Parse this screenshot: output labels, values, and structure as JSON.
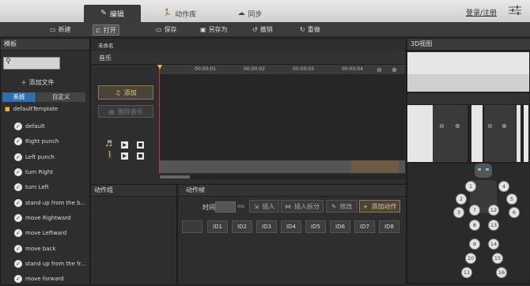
{
  "top_tabs": [
    {
      "label": "编辑"
    },
    {
      "label": "动作库"
    },
    {
      "label": "同步"
    }
  ],
  "account": {
    "login_label": "登录/注册"
  },
  "toolbar": {
    "new": "新建",
    "open": "打开",
    "save": "保存",
    "save_as": "另存为",
    "undo": "撤销",
    "redo": "重做"
  },
  "left_panel": {
    "title": "模板",
    "search_placeholder": "",
    "add_file": "添加文件",
    "seg_system": "系统",
    "seg_custom": "自定义",
    "folder": "defaultTemplate",
    "items": [
      "default",
      "Right punch",
      "Left punch",
      "turn Right",
      "turn Left",
      "stand up from the b...",
      "move Rightward",
      "move Leftward",
      "move back",
      "stand up from the fr...",
      "move forward"
    ]
  },
  "editor": {
    "title": "未命名",
    "music_label": "音乐",
    "add_button": "添加",
    "delete_music": "删除音乐",
    "timeline_ticks": [
      "00:00:01",
      "00:00:02",
      "00:00:03",
      "00:00:04"
    ]
  },
  "action_group": {
    "title": "动作组"
  },
  "action_frames": {
    "title": "动作帧",
    "time_label": "时间",
    "time_unit": "ms",
    "insert": "插入",
    "insert_split": "插入拆分",
    "modify": "修改",
    "add_action": "添加动作",
    "ids": [
      "ID1",
      "ID2",
      "ID3",
      "ID4",
      "ID5",
      "ID6",
      "ID7",
      "ID8"
    ]
  },
  "view3d": {
    "title": "3D视图",
    "joints": [
      "1",
      "2",
      "3",
      "4",
      "5",
      "6",
      "7",
      "8",
      "9",
      "10",
      "11",
      "12",
      "13",
      "14",
      "15",
      "16"
    ]
  },
  "colors": {
    "accent": "#e4c98a",
    "playhead": "#c0392b",
    "timeline_highlight": "#6b5d45"
  }
}
